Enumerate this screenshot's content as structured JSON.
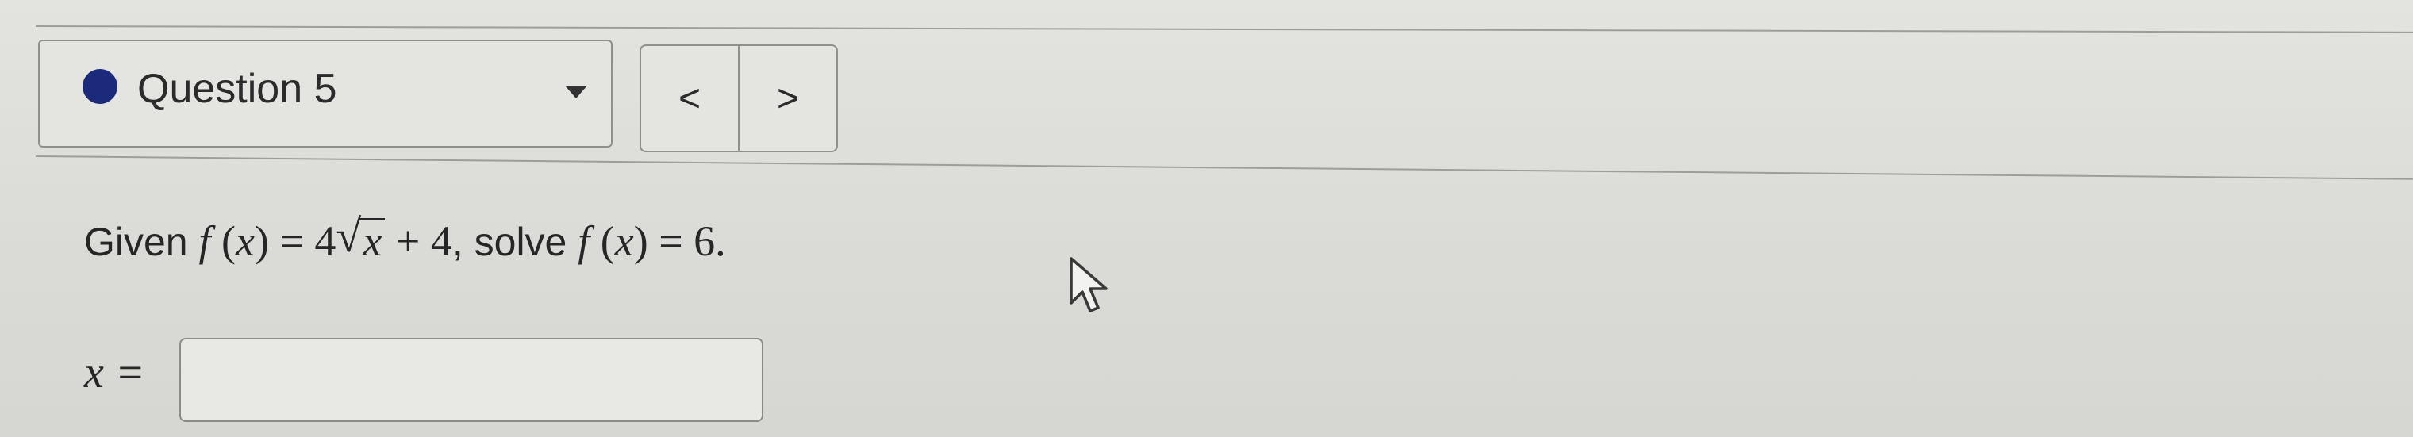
{
  "question_selector": {
    "label": "Question 5",
    "status_color": "#1b2a7a",
    "caret_icon": "caret-down-icon"
  },
  "navigation": {
    "prev_label": "<",
    "next_label": ">"
  },
  "problem": {
    "prefix": "Given ",
    "f_lhs": "f",
    "paren_open": " (",
    "var": "x",
    "paren_close": ") = 4",
    "radicand": "x",
    "plus_term": " + 4",
    "connector": ", solve ",
    "f_solve": "f",
    "solve_paren_open": " (",
    "solve_var": "x",
    "solve_rhs": ") = 6."
  },
  "answer": {
    "label": "x =",
    "value": "",
    "placeholder": ""
  },
  "colors": {
    "accent": "#1b2a7a",
    "background": "#dcdcd8",
    "border": "#8f8f8b"
  }
}
